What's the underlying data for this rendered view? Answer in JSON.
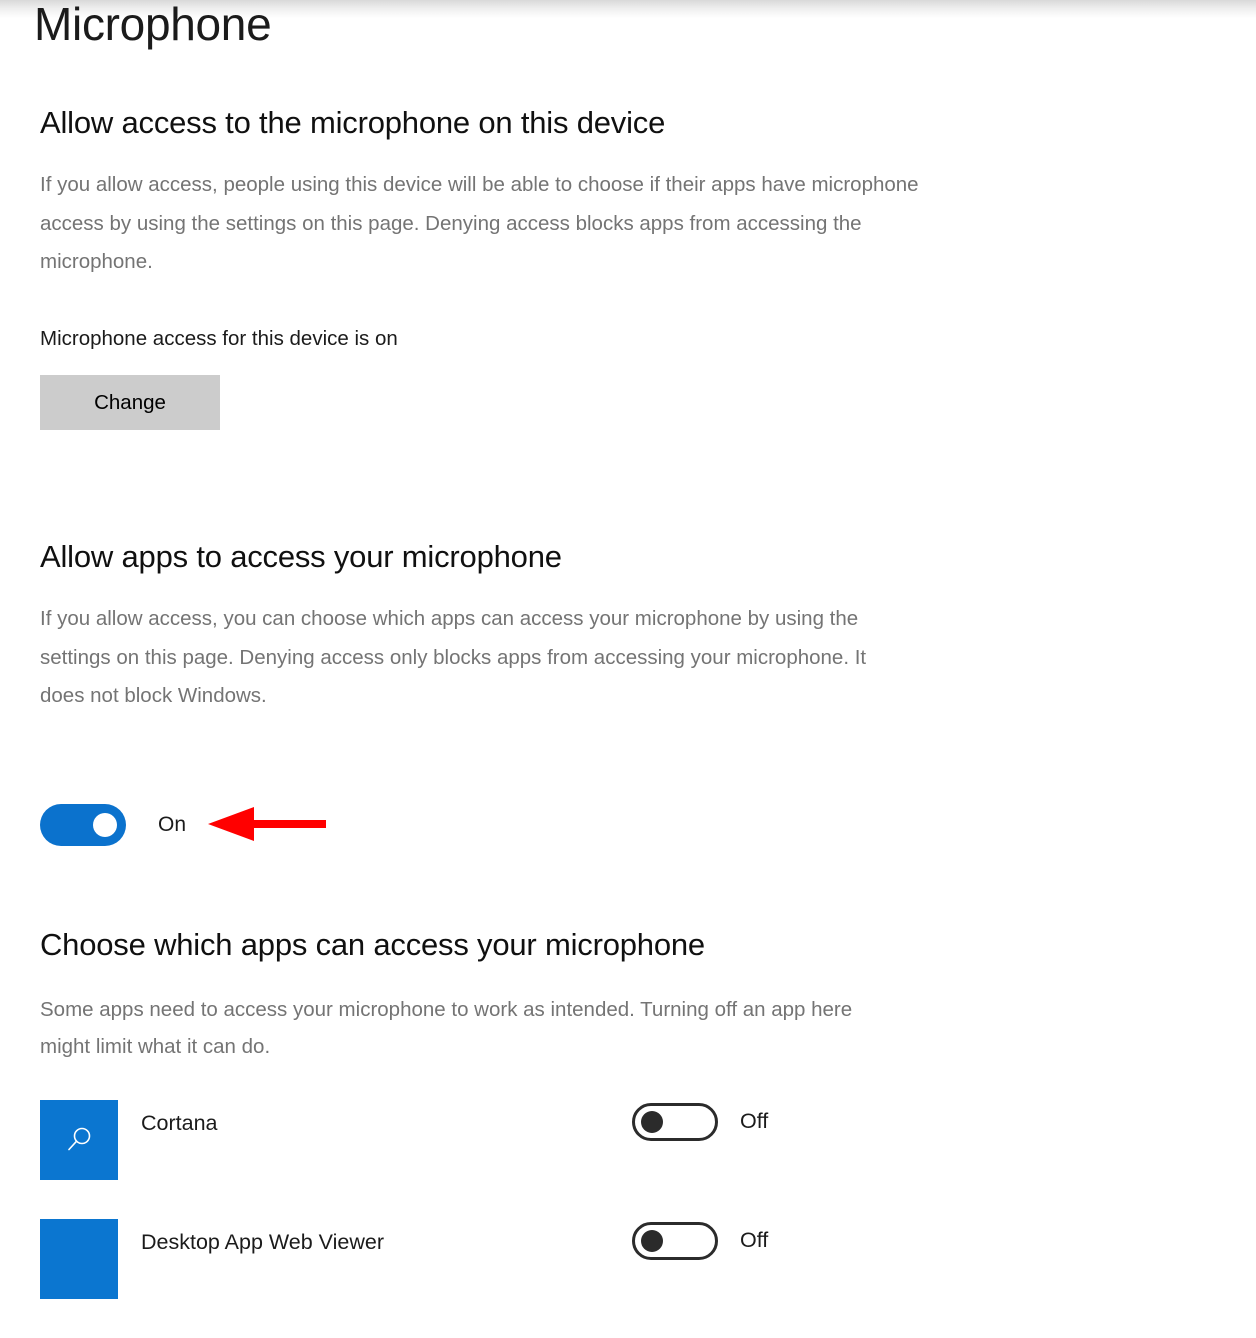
{
  "page": {
    "title": "Microphone"
  },
  "device_access": {
    "heading": "Allow access to the microphone on this device",
    "description": "If you allow access, people using this device will be able to choose if their apps have microphone access by using the settings on this page. Denying access blocks apps from accessing the microphone.",
    "status_text": "Microphone access for this device is on",
    "change_button_label": "Change"
  },
  "apps_access": {
    "heading": "Allow apps to access your microphone",
    "description": "If you allow access, you can choose which apps can access your microphone by using the settings on this page. Denying access only blocks apps from accessing your microphone. It does not block Windows.",
    "toggle_state_label": "On"
  },
  "app_chooser": {
    "heading": "Choose which apps can access your microphone",
    "description": "Some apps need to access your microphone to work as intended. Turning off an app here might limit what it can do.",
    "apps": [
      {
        "name": "Cortana",
        "state_label": "Off",
        "icon": "search-icon",
        "icon_color": "#0b76d0"
      },
      {
        "name": "Desktop App Web Viewer",
        "state_label": "Off",
        "icon": "blank-tile-icon",
        "icon_color": "#0b76d0"
      }
    ]
  },
  "annotation": {
    "arrow_color": "#ff0000",
    "arrow_direction": "left"
  },
  "colors": {
    "accent_blue": "#0b72cd",
    "button_grey": "#cccccc",
    "body_text_grey": "#747474"
  }
}
